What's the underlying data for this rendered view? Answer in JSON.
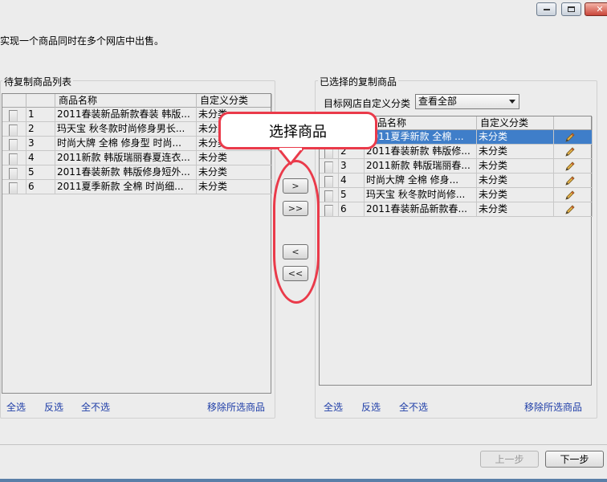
{
  "instruction": "实现一个商品同时在多个网店中出售。",
  "left_panel": {
    "title": "待复制商品列表",
    "columns": [
      "商品名称",
      "自定义分类"
    ],
    "rows": [
      {
        "index": "1",
        "name": "2011春装新品新款春装 韩版...",
        "category": "未分类"
      },
      {
        "index": "2",
        "name": "玛天宝 秋冬款时尚修身男长...",
        "category": "未分类"
      },
      {
        "index": "3",
        "name": "时尚大牌 全棉 修身型 时尚...",
        "category": "未分类"
      },
      {
        "index": "4",
        "name": "2011新款 韩版瑞丽春夏连衣...",
        "category": "未分类"
      },
      {
        "index": "5",
        "name": "2011春装新款 韩版修身短外...",
        "category": "未分类"
      },
      {
        "index": "6",
        "name": "2011夏季新款 全棉 时尚细...",
        "category": "未分类"
      }
    ],
    "links": {
      "select_all": "全选",
      "invert": "反选",
      "select_none": "全不选",
      "remove_selected": "移除所选商品"
    }
  },
  "right_panel": {
    "title": "已选择的复制商品",
    "filter_label": "目标网店自定义分类",
    "filter_value": "查看全部",
    "columns": [
      "商品名称",
      "自定义分类"
    ],
    "rows": [
      {
        "index": "1",
        "name": "2011夏季新款 全棉 ...",
        "category": "未分类",
        "selected": true
      },
      {
        "index": "2",
        "name": "2011春装新款 韩版修...",
        "category": "未分类"
      },
      {
        "index": "3",
        "name": "2011新款 韩版瑞丽春...",
        "category": "未分类"
      },
      {
        "index": "4",
        "name": "时尚大牌 全棉 修身...",
        "category": "未分类"
      },
      {
        "index": "5",
        "name": "玛天宝 秋冬款时尚修...",
        "category": "未分类"
      },
      {
        "index": "6",
        "name": "2011春装新品新款春...",
        "category": "未分类"
      }
    ],
    "links": {
      "select_all": "全选",
      "invert": "反选",
      "select_none": "全不选",
      "remove_selected": "移除所选商品"
    }
  },
  "move_buttons": {
    "add_one": ">",
    "add_all": ">>",
    "remove_one": "<",
    "remove_all": "<<"
  },
  "callout": {
    "text": "选择商品",
    "color": "#ea3a4a"
  },
  "nav": {
    "prev": "上一步",
    "next": "下一步"
  },
  "icons": {
    "edit": "pencil-icon",
    "minimize": "minimize-icon",
    "maximize": "maximize-icon",
    "close": "close-icon"
  }
}
